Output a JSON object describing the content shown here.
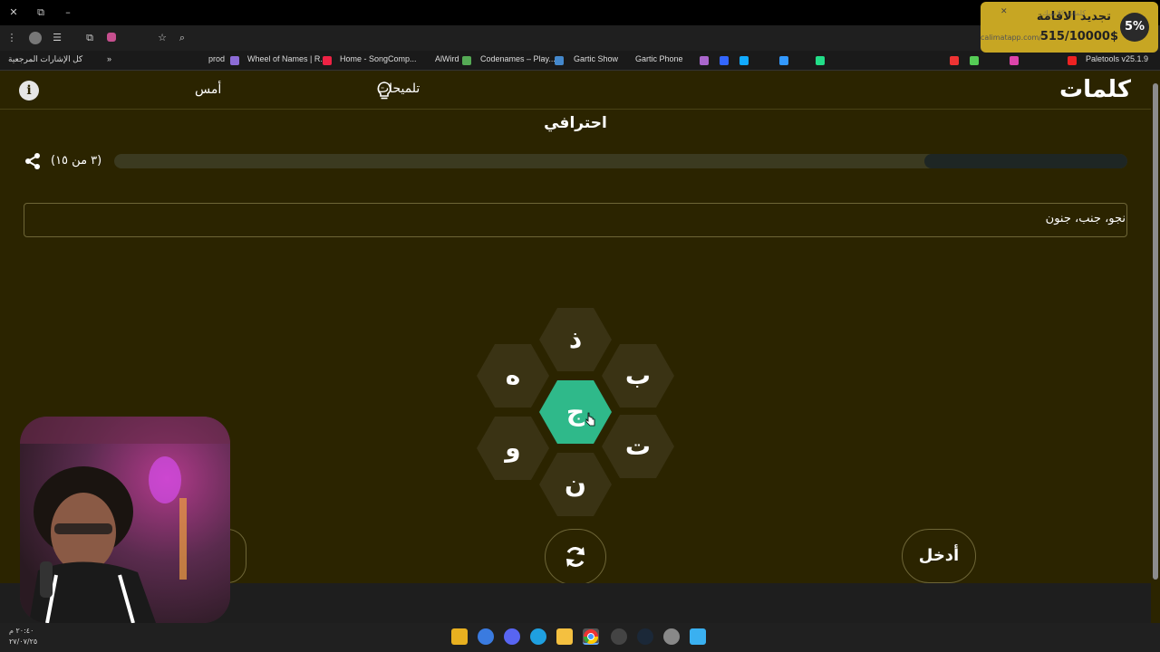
{
  "browser": {
    "bookmarks_label": "كل الإشارات المرجعية",
    "bookmarks": [
      "prod",
      "Wheel of Names | R...",
      "Home - SongComp...",
      "AlWird",
      "Codenames – Play...",
      "Gartic Show",
      "Gartic Phone",
      "Paletools v25.1.9"
    ]
  },
  "notification": {
    "percent": "5%",
    "title": "تجديد الاقامة",
    "subtitle": "515/10000$",
    "url": "calimatapp.com/",
    "header": "كلمات كلاسيك"
  },
  "app": {
    "logo": "كلمات",
    "hints_label": "تلميحات",
    "yesterday_label": "أمس",
    "info_icon": "i",
    "level": "احترافي",
    "score": "(٣ من ١٥)",
    "progress_fraction": 0.2,
    "found_words": "نجو، جنب، جنون",
    "letters": {
      "center": "ج",
      "top": "ذ",
      "top_right": "ب",
      "bottom_right": "ت",
      "bottom": "ن",
      "bottom_left": "و",
      "top_left": "ه"
    },
    "enter_label": "أدخل",
    "shuffle_icon": "refresh-icon"
  },
  "taskbar": {
    "clock": "٢٠:٤٠ م",
    "date": "٢٧/٠٧/٢٥"
  },
  "colors": {
    "background": "#2b2400",
    "center_hex": "#2fb98a",
    "hex": "#3a3314",
    "notification": "#c7a623"
  }
}
